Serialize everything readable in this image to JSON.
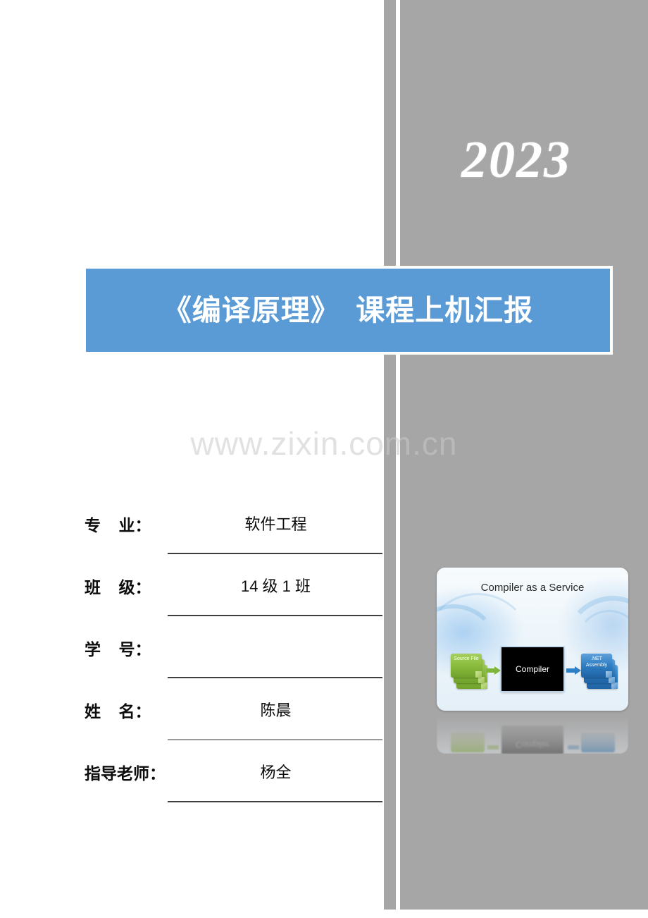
{
  "page": {
    "background_color": "#ffffff",
    "gray_panel_color": "#a6a6a6",
    "accent_blue": "#5b9bd5"
  },
  "year": "2023",
  "title": {
    "text": "《编译原理》  课程上机汇报"
  },
  "watermark": {
    "text": "www.zixin.com.cn"
  },
  "fields": [
    {
      "label": "专    业：",
      "value": "软件工程"
    },
    {
      "label": "班    级：",
      "value": "14 级 1 班"
    },
    {
      "label": "学    号：",
      "value": ""
    },
    {
      "label": "姓    名：",
      "value": "陈晨"
    },
    {
      "label": "指导老师：",
      "value": "杨全"
    }
  ],
  "diagram": {
    "title": "Compiler as a Service",
    "source_label": "Source\nFile",
    "compiler_label": "Compiler",
    "assembly_label": ".NET\nAssembly",
    "source_color": "#8cbd3f",
    "assembly_color": "#2f7fc4",
    "compiler_color": "#000000"
  }
}
